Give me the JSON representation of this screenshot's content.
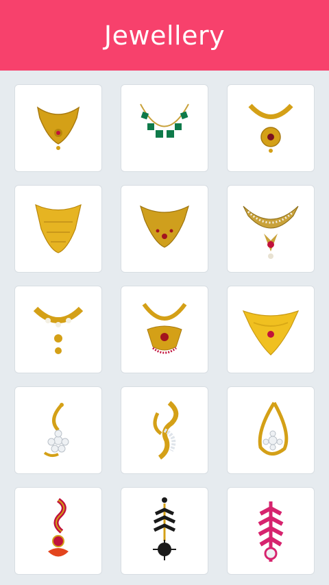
{
  "app": {
    "title": "Jewellery"
  },
  "colors": {
    "header_bg": "#f7416c",
    "page_bg": "#e6ebef",
    "tile_bg": "#ffffff",
    "gold": "#d4a017",
    "emerald": "#0e7a4a",
    "ruby": "#c1123b",
    "magenta": "#d6246e"
  },
  "items": [
    {
      "icon": "gold-choker-necklace-icon"
    },
    {
      "icon": "emerald-necklace-icon"
    },
    {
      "icon": "gold-pendant-necklace-icon"
    },
    {
      "icon": "gold-bib-necklace-icon"
    },
    {
      "icon": "gold-beaded-necklace-icon"
    },
    {
      "icon": "kundan-necklace-icon"
    },
    {
      "icon": "gold-stone-necklace-icon"
    },
    {
      "icon": "temple-necklace-icon"
    },
    {
      "icon": "gold-v-necklace-icon"
    },
    {
      "icon": "diamond-pendant-icon"
    },
    {
      "icon": "swirl-pendant-icon"
    },
    {
      "icon": "teardrop-pendant-icon"
    },
    {
      "icon": "red-bindi-icon"
    },
    {
      "icon": "black-bindi-icon"
    },
    {
      "icon": "pink-bindi-icon"
    }
  ]
}
